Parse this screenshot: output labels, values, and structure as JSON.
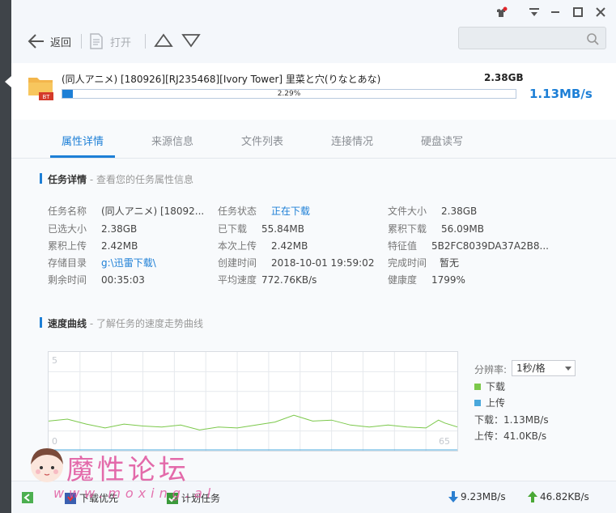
{
  "toolbar": {
    "back_label": "返回",
    "open_label": "打开",
    "search_placeholder": ""
  },
  "task": {
    "name": "(同人アニメ) [180926][RJ235468][Ivory Tower] 里菜と穴(りなとあな)",
    "size": "2.38GB",
    "progress_text": "2.29%",
    "progress_fraction": 0.0229,
    "speed": "1.13MB/s",
    "badge": "BT"
  },
  "tabs": [
    "属性详情",
    "来源信息",
    "文件列表",
    "连接情况",
    "硬盘读写"
  ],
  "details": {
    "title": "任务详情",
    "subtitle": " - 查看您的任务属性信息",
    "col1": [
      {
        "k": "任务名称",
        "v": "(同人アニメ) [18092..."
      },
      {
        "k": "已选大小",
        "v": "2.38GB"
      },
      {
        "k": "累积上传",
        "v": "2.42MB"
      },
      {
        "k": "存储目录",
        "v": "g:\\迅雷下载\\"
      },
      {
        "k": "剩余时间",
        "v": "00:35:03"
      }
    ],
    "col2": [
      {
        "k": "任务状态",
        "v": "正在下载"
      },
      {
        "k": "已下载",
        "v": "55.84MB"
      },
      {
        "k": "本次上传",
        "v": "2.42MB"
      },
      {
        "k": "创建时间",
        "v": "2018-10-01 19:59:02"
      },
      {
        "k": "平均速度",
        "v": "772.76KB/s"
      }
    ],
    "col3": [
      {
        "k": "文件大小",
        "v": "2.38GB"
      },
      {
        "k": "累积下载",
        "v": "56.09MB"
      },
      {
        "k": "特征值",
        "v": "5B2FC8039DA37A2B8..."
      },
      {
        "k": "完成时间",
        "v": "暂无"
      },
      {
        "k": "健康度",
        "v": "1799%"
      }
    ]
  },
  "speed_section": {
    "title": "速度曲线",
    "subtitle": " - 了解任务的速度走势曲线",
    "resolution_label": "分辨率:",
    "resolution_value": "1秒/格",
    "legend_download": "下载",
    "legend_upload": "上传",
    "download_readout": "下载：1.13MB/s",
    "upload_readout": "上传：41.0KB/s",
    "y_top_label": "5",
    "y_bottom_label": "0",
    "x_right_label": "65",
    "colors": {
      "download": "#7bc84a",
      "upload": "#4aa8dc"
    }
  },
  "chart_data": {
    "type": "line",
    "title": "",
    "ylim": [
      0,
      5
    ],
    "xlim": [
      0,
      65
    ],
    "series": [
      {
        "name": "下载",
        "x": [
          0,
          3,
          6,
          9,
          12,
          15,
          18,
          21,
          24,
          27,
          30,
          33,
          36,
          39,
          42,
          45,
          48,
          51,
          54,
          57,
          60,
          62,
          63,
          65
        ],
        "values": [
          1.5,
          1.6,
          1.35,
          1.15,
          1.35,
          1.25,
          1.2,
          1.3,
          1.05,
          1.2,
          1.15,
          1.3,
          1.45,
          1.8,
          1.5,
          1.55,
          1.3,
          1.2,
          1.3,
          1.2,
          1.15,
          1.55,
          1.4,
          1.2
        ]
      },
      {
        "name": "上传",
        "x": [
          0,
          10,
          20,
          30,
          40,
          50,
          60,
          65
        ],
        "values": [
          0.04,
          0.04,
          0.04,
          0.04,
          0.04,
          0.04,
          0.04,
          0.04
        ]
      }
    ]
  },
  "statusbar": {
    "priority_label": "下载优先",
    "schedule_label": "计划任务",
    "down_speed": "9.23MB/s",
    "up_speed": "46.82KB/s"
  },
  "watermark": {
    "text": "魔性论坛",
    "url": "www.moxing.al"
  }
}
